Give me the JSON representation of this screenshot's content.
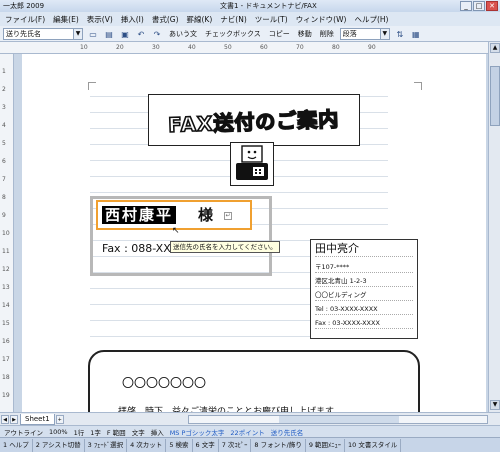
{
  "window": {
    "app_name": "一太郎 2009",
    "doc_title": "文書1 - ドキュメントナビ/FAX",
    "min": "_",
    "max": "□",
    "close": "✕"
  },
  "menu": [
    "ファイル(F)",
    "編集(E)",
    "表示(V)",
    "挿入(I)",
    "書式(G)",
    "罫線(K)",
    "ナビ(N)",
    "ツール(T)",
    "ウィンドウ(W)",
    "ヘルプ(H)"
  ],
  "toolbar": {
    "style_combo": "送り先氏名",
    "aiueo": "あいう文",
    "checkbox": "チェックボックス",
    "copy": "コピー",
    "move": "移動",
    "delete": "削除",
    "paragraph_combo": "段落"
  },
  "ruler_h": [
    "10",
    "20",
    "30",
    "40",
    "50",
    "60",
    "70",
    "80",
    "90"
  ],
  "ruler_v": [
    "1",
    "2",
    "3",
    "4",
    "5",
    "6",
    "7",
    "8",
    "9",
    "10",
    "11",
    "12",
    "13",
    "14",
    "15",
    "16",
    "17",
    "18",
    "19"
  ],
  "document": {
    "fax_title": "FAX送付のご案内",
    "recipient_name": "西村康平",
    "recipient_honorific": "様",
    "fax_line": "Fax : 088-XX",
    "tooltip": "送信先の氏名を入力してください。",
    "sender": {
      "name": "田中亮介",
      "postal": "〒107-****",
      "address1": "港区北青山 1-2-3",
      "building": "〇〇ビルディング",
      "tel": "Tel : 03-XXXX-XXXX",
      "fax": "Fax : 03-XXXX-XXXX"
    },
    "circles_text": "〇〇〇〇〇〇〇",
    "greeting": "拝啓　時下、益々ご清栄のこととお慶び申し上げます。"
  },
  "sheet_tab": "Sheet1",
  "status": {
    "outline": "アウトライン",
    "zoom": "100%",
    "line": "1行",
    "char": "1字",
    "range": "F 範囲",
    "chars": "文字",
    "insert": "挿入",
    "font": "MS Pゴシック太字",
    "size": "22ポイント",
    "field": "送り先氏名"
  },
  "fkeys": [
    "1 ヘルプ",
    "2 アシスト切替",
    "3 ﾌｪｰﾄﾞ選択",
    "4 次カット",
    "5 検索",
    "6 文字",
    "7 次ｺﾋﾟｰ",
    "8 フォント/飾り",
    "9 範囲ﾒﾆｭｰ",
    "10 文書スタイル"
  ]
}
